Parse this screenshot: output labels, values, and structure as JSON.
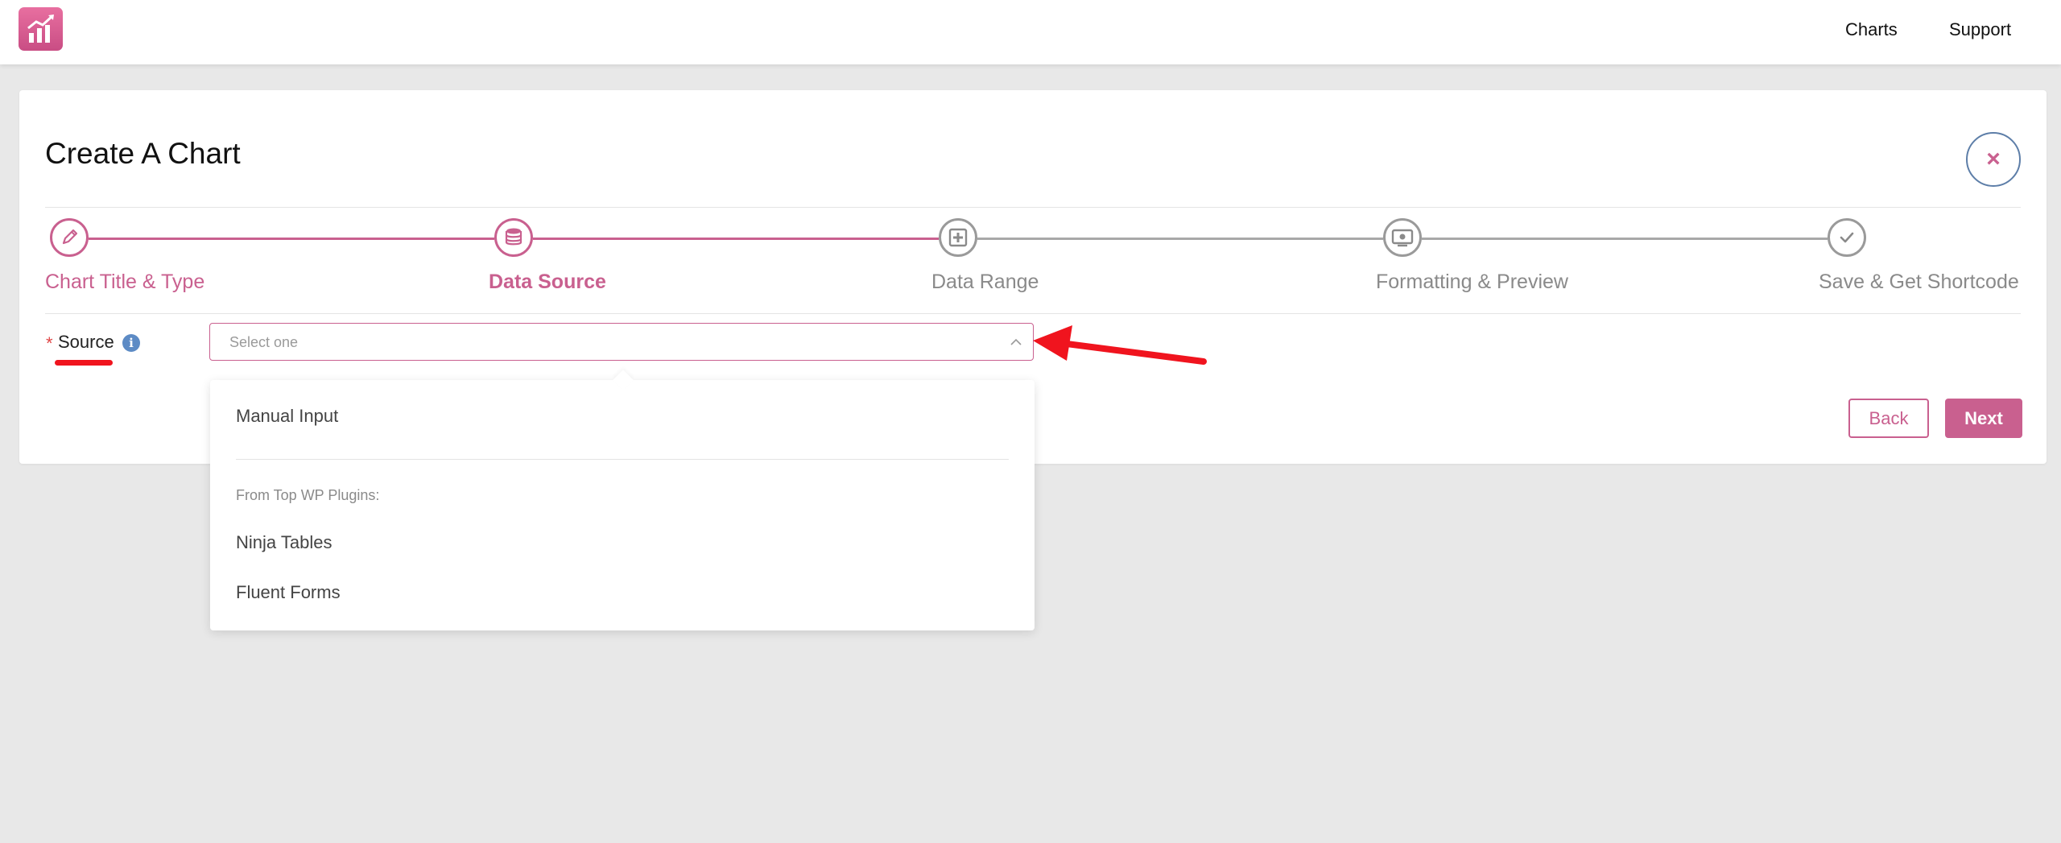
{
  "header": {
    "nav": [
      {
        "label": "Charts"
      },
      {
        "label": "Support"
      }
    ]
  },
  "page": {
    "title": "Create A Chart",
    "close_label": "×"
  },
  "steps": [
    {
      "label": "Chart Title & Type",
      "status": "completed",
      "icon": "pencil-icon"
    },
    {
      "label": "Data Source",
      "status": "active",
      "icon": "database-icon"
    },
    {
      "label": "Data Range",
      "status": "pending",
      "icon": "data-range-icon"
    },
    {
      "label": "Formatting & Preview",
      "status": "pending",
      "icon": "preview-icon"
    },
    {
      "label": "Save & Get Shortcode",
      "status": "pending",
      "icon": "check-icon"
    }
  ],
  "form": {
    "required_mark": "*",
    "source_label": "Source",
    "info_glyph": "i",
    "source_placeholder": "Select one"
  },
  "buttons": {
    "back": "Back",
    "next": "Next"
  },
  "dropdown": {
    "items": [
      "Manual Input"
    ],
    "group_label": "From Top WP Plugins:",
    "group_items": [
      "Ninja Tables",
      "Fluent Forms"
    ]
  },
  "colors": {
    "accent": "#c9608f",
    "inactive": "#9a9a9a",
    "annotation": "#f0141e",
    "close_border": "#5d7ea8"
  }
}
